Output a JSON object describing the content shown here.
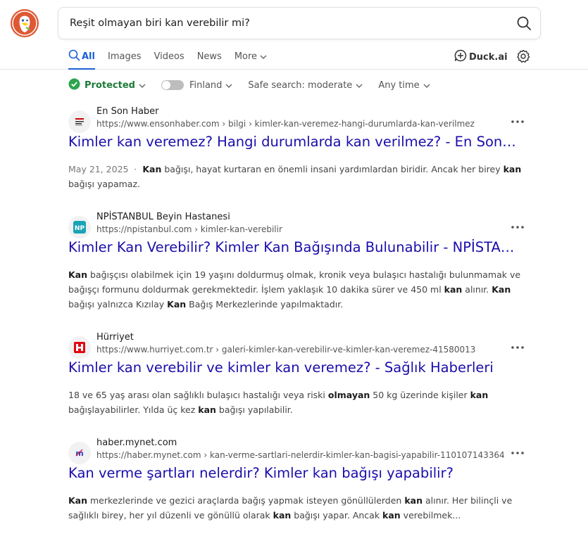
{
  "search": {
    "query": "Reşit olmayan biri kan verebilir mi?"
  },
  "tabs": [
    {
      "label": "All",
      "active": true
    },
    {
      "label": "Images"
    },
    {
      "label": "Videos"
    },
    {
      "label": "News"
    },
    {
      "label": "More"
    }
  ],
  "duckai": {
    "label": "Duck.ai"
  },
  "filters": {
    "protected": "Protected",
    "region": "Finland",
    "safe_search": "Safe search: moderate",
    "time": "Any time"
  },
  "colors": {
    "link": "#1a0dab",
    "accent": "#1c5fd6",
    "protected": "#1e7a3a"
  },
  "results": [
    {
      "site_name": "En Son Haber",
      "url": "https://www.ensonhaber.com › bilgi › kimler-kan-veremez-hangi-durumlarda-kan-verilmez",
      "title": "Kimler kan veremez? Hangi durumlarda kan verilmez? - En Son Haber",
      "date": "May 21, 2025",
      "snippet_html": "<b>Kan</b> bağışı, hayat kurtaran en önemli insani yardımlardan biridir. Ancak her birey <b>kan</b> bağışı yapamaz."
    },
    {
      "site_name": "NPİSTANBUL Beyin Hastanesi",
      "url": "https://npistanbul.com › kimler-kan-verebilir",
      "title": "Kimler Kan Verebilir? Kimler Kan Bağışında Bulunabilir - NPİSTANBUL Beyin Hastanesi",
      "date": "",
      "snippet_html": "<b>Kan</b> bağışçısı olabilmek için 19 yaşını doldurmuş olmak, kronik veya bulaşıcı hastalığı bulunmamak ve bağışçı formunu doldurmak gerekmektedir. İşlem yaklaşık 10 dakika sürer ve 450 ml <b>kan</b> alınır. <b>Kan</b> bağışı yalnızca Kızılay <b>Kan</b> Bağış Merkezlerinde yapılmaktadır."
    },
    {
      "site_name": "Hürriyet",
      "url": "https://www.hurriyet.com.tr › galeri-kimler-kan-verebilir-ve-kimler-kan-veremez-41580013",
      "title": "Kimler kan verebilir ve kimler kan veremez? - Sağlık Haberleri",
      "date": "",
      "snippet_html": "18 ve 65 yaş arası olan sağlıklı bulaşıcı hastalığı veya riski <b>olmayan</b> 50 kg üzerinde kişiler <b>kan</b> bağışlayabilirler. Yılda üç kez <b>kan</b> bağışı yapılabilir."
    },
    {
      "site_name": "haber.mynet.com",
      "url": "https://haber.mynet.com › kan-verme-sartlari-nelerdir-kimler-kan-bagisi-yapabilir-110107143364",
      "title": "Kan verme şartları nelerdir? Kimler kan bağışı yapabilir?",
      "date": "",
      "snippet_html": "<b>Kan</b> merkezlerinde ve gezici araçlarda bağış yapmak isteyen gönüllülerden <b>kan</b> alınır. Her bilinçli ve sağlıklı birey, her yıl düzenli ve gönüllü olarak <b>kan</b> bağışı yapar. Ancak <b>kan</b> verebilmek..."
    }
  ]
}
